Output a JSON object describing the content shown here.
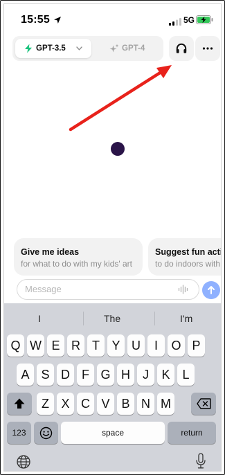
{
  "status_bar": {
    "time": "15:55",
    "network": "5G",
    "icons": [
      "location-arrow-icon",
      "signal-bars-icon",
      "battery-charging-icon"
    ]
  },
  "models": {
    "active_label": "GPT-3.5",
    "inactive_label": "GPT-4",
    "active_icon": "bolt-icon",
    "inactive_icon": "sparkles-icon",
    "accent_color": "#19c37d"
  },
  "toolbar": {
    "icons": [
      "headphones-icon",
      "more-horizontal-icon"
    ]
  },
  "annotation": {
    "arrow_color": "#e8221b"
  },
  "suggestions": [
    {
      "title": "Give me ideas",
      "subtitle": "for what to do with my kids' art"
    },
    {
      "title": "Suggest fun activiti",
      "subtitle": "to do indoors with m"
    }
  ],
  "composer": {
    "placeholder": "Message",
    "send_color": "#8fb1ff"
  },
  "keyboard": {
    "predictions": [
      "I",
      "The",
      "I'm"
    ],
    "rows": [
      [
        "Q",
        "W",
        "E",
        "R",
        "T",
        "Y",
        "U",
        "I",
        "O",
        "P"
      ],
      [
        "A",
        "S",
        "D",
        "F",
        "G",
        "H",
        "J",
        "K",
        "L"
      ],
      [
        "Z",
        "X",
        "C",
        "V",
        "B",
        "N",
        "M"
      ]
    ],
    "numbers_key": "123",
    "space_key": "space",
    "return_key": "return"
  }
}
